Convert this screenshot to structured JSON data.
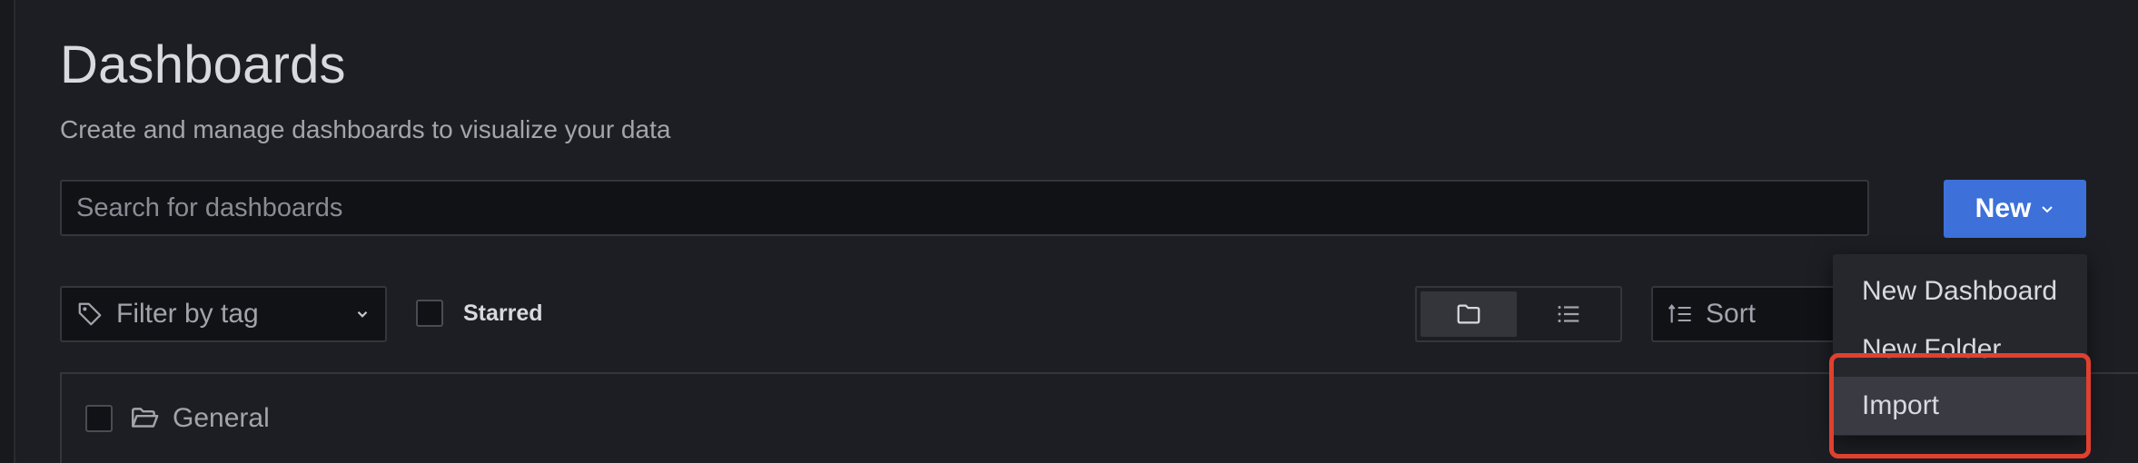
{
  "header": {
    "title": "Dashboards",
    "subtitle": "Create and manage dashboards to visualize your data"
  },
  "search": {
    "placeholder": "Search for dashboards",
    "value": ""
  },
  "new_button": {
    "label": "New",
    "color": "#3d71d9"
  },
  "filters": {
    "tag_filter_label": "Filter by tag",
    "starred_label": "Starred",
    "starred_checked": false,
    "view_mode": "folder",
    "sort_label": "Sort"
  },
  "folders": [
    {
      "name": "General",
      "icon": "folder-open-icon"
    }
  ],
  "new_menu": {
    "items": [
      {
        "label": "New Dashboard"
      },
      {
        "label": "New Folder"
      },
      {
        "label": "Import"
      }
    ],
    "highlighted_item": "Import",
    "highlight_color": "#e0402f"
  }
}
